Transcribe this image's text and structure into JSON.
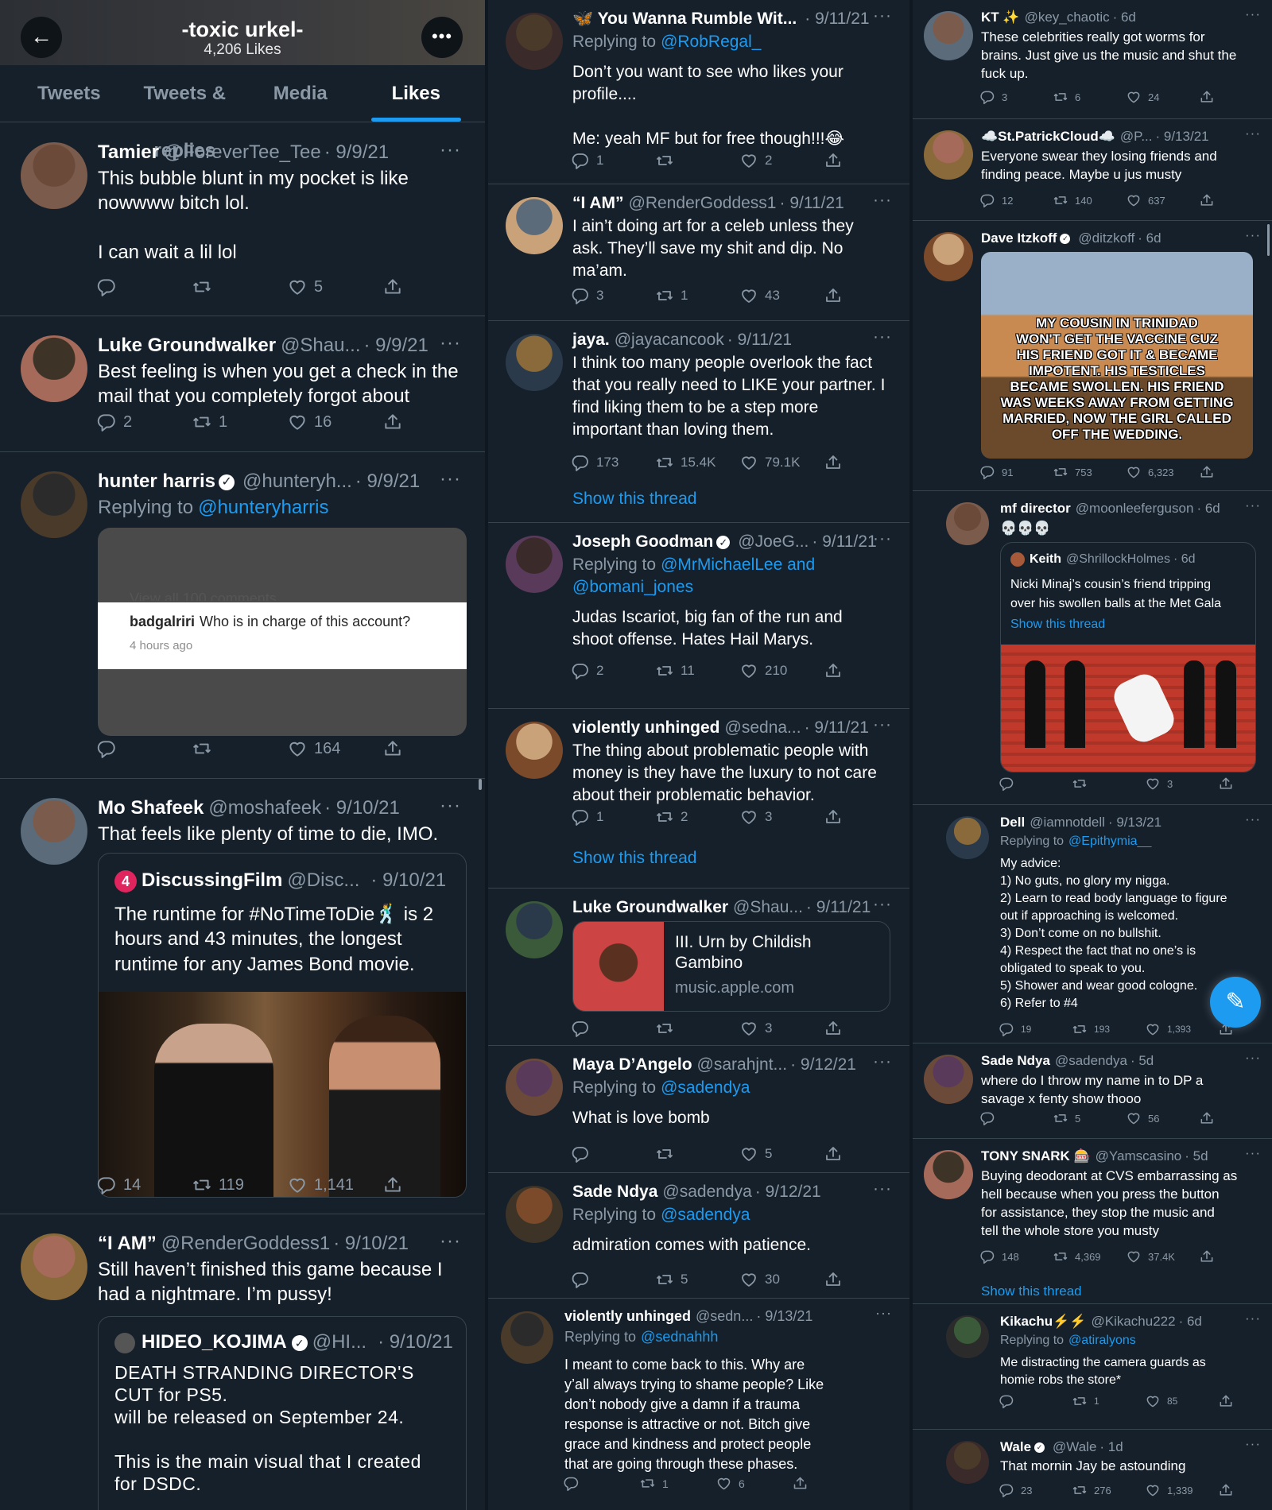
{
  "header": {
    "back_icon": "arrow-left-icon",
    "title": "-toxic urkel-",
    "likes": "4,206 Likes",
    "more_icon": "more-icon"
  },
  "tabs": [
    "Tweets",
    "Tweets & replies",
    "Media",
    "Likes"
  ],
  "col1": [
    {
      "name": "Tamier",
      "handle": "@ForeverTee_Tee",
      "date": "· 9/9/21",
      "lines": [
        "This bubble blunt in my pocket is like",
        "nowwww bitch lol.",
        "",
        "I can wait a lil lol"
      ],
      "reply": "",
      "retweet": "",
      "like": "5"
    },
    {
      "name": "Luke Groundwalker",
      "handle": "@Shau...",
      "date": "· 9/9/21",
      "lines": [
        "Best feeling is when you get a check in the",
        "mail that you completely forgot about"
      ],
      "reply": "2",
      "retweet": "1",
      "like": "16"
    },
    {
      "name": "hunter harris",
      "handle": "@hunteryh...",
      "date": "· 9/9/21",
      "replying": "Replying to",
      "replying_to": "@hunteryharris",
      "media": {
        "cut_text": "View all 100 comments",
        "user": "badgalriri",
        "comment": "Who is in charge of this account?",
        "time": "4 hours ago"
      },
      "reply": "",
      "retweet": "",
      "like": "164"
    },
    {
      "name": "Mo Shafeek",
      "handle": "@moshafeek",
      "date": "· 9/10/21",
      "lines": [
        "That feels like plenty of time to die, IMO."
      ],
      "quote": {
        "name": "DiscussingFilm",
        "handle": "@Disc...",
        "date": "· 9/10/21",
        "lines": [
          "The runtime for #NoTimeToDie🕺 is 2",
          "hours and 43 minutes, the longest",
          "runtime for any James Bond movie."
        ]
      },
      "reply": "14",
      "retweet": "119",
      "like": "1,141"
    },
    {
      "name": "“I AM”",
      "handle": "@RenderGoddess1",
      "date": "· 9/10/21",
      "lines": [
        "Still haven’t finished this game because I",
        "had a nightmare. I’m pussy!"
      ],
      "quote": {
        "name": "HIDEO_KOJIMA",
        "handle": "@HI...",
        "date": "· 9/10/21",
        "lines": [
          "DEATH STRANDING DIRECTOR'S",
          "CUT for PS5.",
          "will be released on September 24.",
          "",
          "This is the main visual that I created",
          "for DSDC."
        ]
      }
    }
  ],
  "col2": [
    {
      "name": "🦋 You Wanna Rumble Wit...",
      "handle": "",
      "date": "· 9/11/21",
      "replying": "Replying to",
      "replying_to": "@RobRegal_",
      "lines": [
        "Don’t you want to see who likes your",
        "profile....",
        "",
        "Me: yeah MF but for free though!!!😂"
      ],
      "reply": "1",
      "retweet": "",
      "like": "2"
    },
    {
      "name": "“I AM”",
      "handle": "@RenderGoddess1",
      "date": "· 9/11/21",
      "lines": [
        "I ain’t doing art for a celeb unless they",
        "ask. They’ll save my shit and dip. No",
        "ma’am."
      ],
      "reply": "3",
      "retweet": "1",
      "like": "43"
    },
    {
      "name": "jaya.",
      "handle": "@jayacancook",
      "date": "· 9/11/21",
      "lines": [
        "I think too many people overlook the fact",
        "that you really need to LIKE your partner. I",
        "find liking them to be a step more",
        "important than loving them."
      ],
      "reply": "173",
      "retweet": "15.4K",
      "like": "79.1K",
      "show_thread": "Show this thread"
    },
    {
      "name": "Joseph Goodman",
      "handle": "@JoeG...",
      "date": "· 9/11/21",
      "replying": "Replying to",
      "replying_to": "@MrMichaelLee and",
      "replying_to2": "@bomani_jones",
      "lines": [
        "Judas Iscariot, big fan of the run and",
        "shoot offense. Hates Hail Marys."
      ],
      "reply": "2",
      "retweet": "11",
      "like": "210"
    },
    {
      "name": "violently unhinged",
      "handle": "@sedna...",
      "date": "· 9/11/21",
      "lines": [
        "The thing about problematic people with",
        "money is they have the luxury to not care",
        "about their problematic behavior."
      ],
      "reply": "1",
      "retweet": "2",
      "like": "3",
      "show_thread": "Show this thread"
    },
    {
      "name": "Luke Groundwalker",
      "handle": "@Shau...",
      "date": "· 9/11/21",
      "card": {
        "title1": "III. Urn by Childish",
        "title2": "Gambino",
        "domain": "music.apple.com"
      },
      "reply": "",
      "retweet": "",
      "like": "3"
    },
    {
      "name": "Maya D’Angelo",
      "handle": "@sarahjnt...",
      "date": "· 9/12/21",
      "replying": "Replying to",
      "replying_to": "@sadendya",
      "lines": [
        "What is love bomb"
      ],
      "reply": "",
      "retweet": "",
      "like": "5"
    },
    {
      "name": "Sade Ndya",
      "handle": "@sadendya",
      "date": "· 9/12/21",
      "replying": "Replying to",
      "replying_to": "@sadendya",
      "lines": [
        "admiration comes with patience."
      ],
      "reply": "",
      "retweet": "5",
      "like": "30"
    },
    {
      "name": "violently unhinged",
      "handle": "@sedn...",
      "date": "· 9/13/21",
      "replying": "Replying to",
      "replying_to": "@sednahhh",
      "lines": [
        "I meant to come back to this. Why are",
        "y’all always trying to shame people? Like",
        "don’t nobody give a damn if a trauma",
        "response is attractive or not. Bitch give",
        "grace and kindness and protect people",
        "that are going through these phases."
      ],
      "reply": "",
      "retweet": "1",
      "like": "6"
    }
  ],
  "col3": [
    {
      "name": "KT ✨",
      "handle": "@key_chaotic",
      "date": "· 6d",
      "lines": [
        "These celebrities really got worms for",
        "brains. Just give us the music and shut the",
        "fuck up."
      ],
      "reply": "3",
      "retweet": "6",
      "like": "24"
    },
    {
      "name": "☁️St.PatrickCloud☁️",
      "handle": "@P...",
      "date": "· 9/13/21",
      "lines": [
        "Everyone swear they losing friends and",
        "finding peace. Maybe u jus musty"
      ],
      "reply": "12",
      "retweet": "140",
      "like": "637"
    },
    {
      "name": "Dave Itzkoff",
      "handle": "@ditzkoff",
      "date": "· 6d",
      "meme": [
        "MY COUSIN IN TRINIDAD",
        "WON'T GET THE VACCINE CUZ",
        "HIS FRIEND GOT IT & BECAME",
        "IMPOTENT. HIS TESTICLES",
        "BECAME SWOLLEN. HIS FRIEND",
        "WAS WEEKS AWAY FROM GETTING",
        "MARRIED, NOW THE GIRL CALLED",
        "OFF THE WEDDING."
      ],
      "reply": "91",
      "retweet": "753",
      "like": "6,323"
    },
    {
      "name": "mf director",
      "handle": "@moonleeferguson",
      "date": "· 6d",
      "lines": [
        "💀💀💀"
      ],
      "quote": {
        "name": "Keith",
        "handle": "@ShrillockHolmes",
        "date": "· 6d",
        "lines": [
          "Nicki Minaj’s cousin’s friend tripping",
          "over his swollen balls at the Met Gala"
        ],
        "show_thread": "Show this thread"
      },
      "reply": "",
      "retweet": "",
      "like": "3"
    },
    {
      "name": "Dell",
      "handle": "@iamnotdell",
      "date": "· 9/13/21",
      "replying": "Replying to",
      "replying_to": "@Epithymia__",
      "lines": [
        "My advice:",
        "1) No guts, no glory my nigga.",
        "2) Learn to read body language to figure",
        "out if approaching is welcomed.",
        "3) Don’t come on no bullshit.",
        "4) Respect the fact that no one’s is",
        "obligated to speak to you.",
        "5) Shower and wear good cologne.",
        "6) Refer to #4"
      ],
      "reply": "19",
      "retweet": "193",
      "like": "1,393"
    },
    {
      "name": "Sade Ndya",
      "handle": "@sadendya",
      "date": "· 5d",
      "lines": [
        "where do I throw my name in to DP a",
        "savage x fenty show thooo"
      ],
      "reply": "",
      "retweet": "5",
      "like": "56"
    },
    {
      "name": "TONY SNARK 🎰",
      "handle": "@Yamscasino",
      "date": "· 5d",
      "lines": [
        "Buying deodorant at CVS embarrassing as",
        "hell because when you press the button",
        "for assistance, they stop the music and",
        "tell the whole store you musty"
      ],
      "reply": "148",
      "retweet": "4,369",
      "like": "37.4K",
      "show_thread": "Show this thread"
    },
    {
      "name": "Kikachu⚡️⚡️",
      "handle": "@Kikachu222",
      "date": "· 6d",
      "replying": "Replying to",
      "replying_to": "@atiralyons",
      "lines": [
        "Me distracting the camera guards as",
        "homie robs the store*"
      ],
      "reply": "",
      "retweet": "1",
      "like": "85"
    },
    {
      "name": "Wale",
      "handle": "@Wale",
      "date": "· 1d",
      "lines": [
        "That mornin Jay be astounding"
      ],
      "reply": "23",
      "retweet": "276",
      "like": "1,339"
    }
  ],
  "fab_icon": "compose-tweet-icon",
  "colors": {
    "bg": "#15202b",
    "accent": "#1d9bf0",
    "muted": "#8b98a5",
    "border": "#38444d"
  }
}
